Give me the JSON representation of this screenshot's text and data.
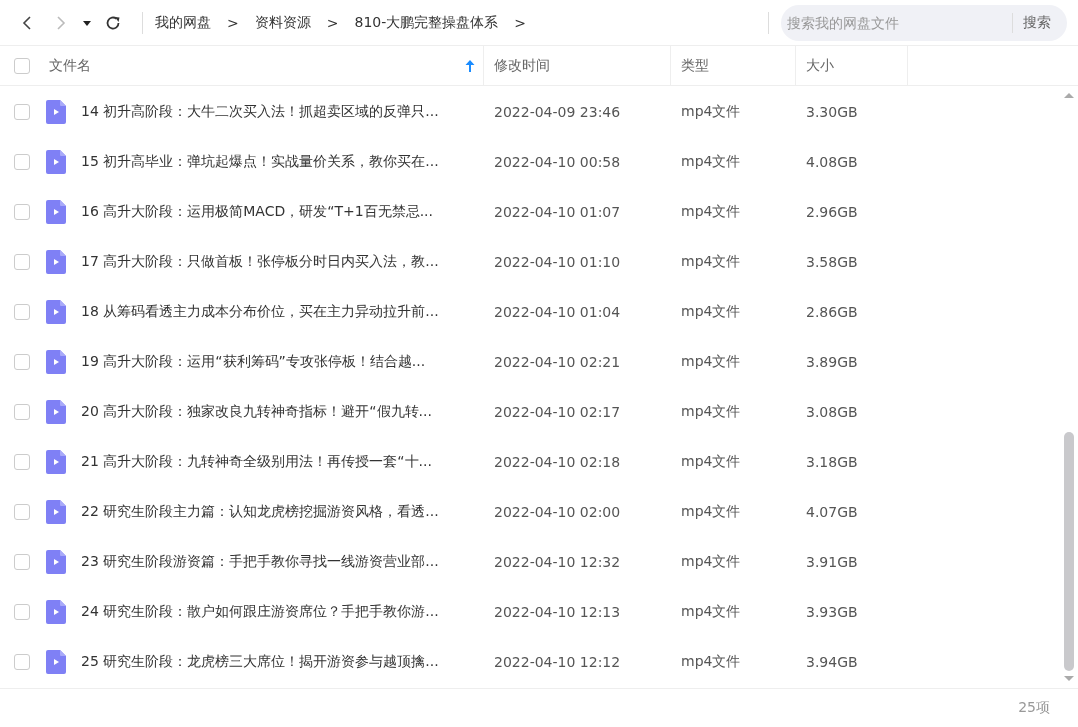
{
  "breadcrumb": [
    "我的网盘",
    "资料资源",
    "810-大鹏完整操盘体系"
  ],
  "breadcrumb_separator": ">",
  "search": {
    "placeholder": "搜索我的网盘文件",
    "button": "搜索"
  },
  "table": {
    "columns": [
      {
        "label": "文件名",
        "sorted": true
      },
      {
        "label": "修改时间",
        "sorted": false
      },
      {
        "label": "类型",
        "sorted": false
      },
      {
        "label": "大小",
        "sorted": false
      }
    ],
    "select_all_checked": false,
    "rows": [
      {
        "name": "14 初升高阶段：大牛二次买入法！抓超卖区域的反弹只...",
        "modified": "2022-04-09 23:46",
        "type": "mp4文件",
        "size": "3.30GB",
        "checked": false
      },
      {
        "name": "15 初升高毕业：弹坑起爆点！实战量价关系，教你买在...",
        "modified": "2022-04-10 00:58",
        "type": "mp4文件",
        "size": "4.08GB",
        "checked": false
      },
      {
        "name": "16 高升大阶段：运用极简MACD，研发“T+1百无禁忌...",
        "modified": "2022-04-10 01:07",
        "type": "mp4文件",
        "size": "2.96GB",
        "checked": false
      },
      {
        "name": "17 高升大阶段：只做首板！张停板分时日内买入法，教...",
        "modified": "2022-04-10 01:10",
        "type": "mp4文件",
        "size": "3.58GB",
        "checked": false
      },
      {
        "name": "18 从筹码看透主力成本分布价位，买在主力异动拉升前...",
        "modified": "2022-04-10 01:04",
        "type": "mp4文件",
        "size": "2.86GB",
        "checked": false
      },
      {
        "name": "19 高升大阶段：运用“获利筹码”专攻张停板！结合越...",
        "modified": "2022-04-10 02:21",
        "type": "mp4文件",
        "size": "3.89GB",
        "checked": false
      },
      {
        "name": "20 高升大阶段：独家改良九转神奇指标！避开“假九转...",
        "modified": "2022-04-10 02:17",
        "type": "mp4文件",
        "size": "3.08GB",
        "checked": false
      },
      {
        "name": "21 高升大阶段：九转神奇全级别用法！再传授一套“十...",
        "modified": "2022-04-10 02:18",
        "type": "mp4文件",
        "size": "3.18GB",
        "checked": false
      },
      {
        "name": "22 研究生阶段主力篇：认知龙虎榜挖掘游资风格，看透...",
        "modified": "2022-04-10 02:00",
        "type": "mp4文件",
        "size": "4.07GB",
        "checked": false
      },
      {
        "name": "23 研究生阶段游资篇：手把手教你寻找一线游资营业部...",
        "modified": "2022-04-10 12:32",
        "type": "mp4文件",
        "size": "3.91GB",
        "checked": false
      },
      {
        "name": "24 研究生阶段：散户如何跟庄游资席位？手把手教你游...",
        "modified": "2022-04-10 12:13",
        "type": "mp4文件",
        "size": "3.93GB",
        "checked": false
      },
      {
        "name": "25 研究生阶段：龙虎榜三大席位！揭开游资参与越顶擒...",
        "modified": "2022-04-10 12:12",
        "type": "mp4文件",
        "size": "3.94GB",
        "checked": false
      }
    ]
  },
  "item_count": "25项"
}
